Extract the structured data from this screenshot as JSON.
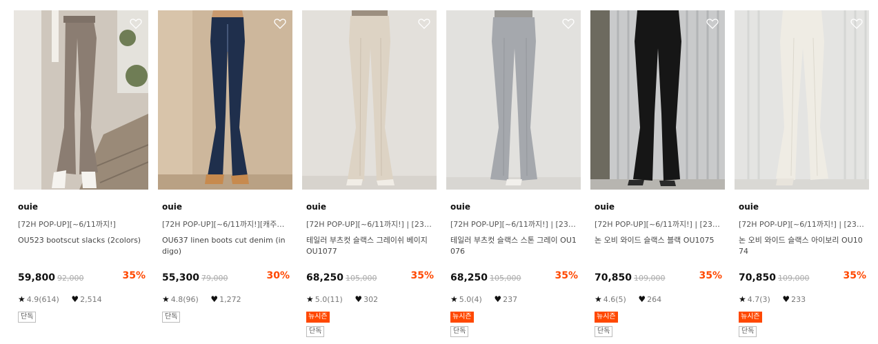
{
  "colors": {
    "accent": "#ff4800",
    "text": "#111111",
    "muted": "#aaaaaa"
  },
  "products": [
    {
      "brand": "ouie",
      "promo": "[72H POP-UP][~6/11까지!]",
      "name": "OU523 bootscut slacks (2colors)",
      "price": "59,800",
      "original_price": "92,000",
      "discount": "35%",
      "rating": "4.9(614)",
      "likes": "2,514",
      "badges": [
        "단독"
      ]
    },
    {
      "brand": "ouie",
      "promo": "[72H POP-UP][~6/11까지!][캐주얼페...",
      "name": "OU637 linen boots cut denim (indigo)",
      "price": "55,300",
      "original_price": "79,000",
      "discount": "30%",
      "rating": "4.8(96)",
      "likes": "1,272",
      "badges": [
        "단독"
      ]
    },
    {
      "brand": "ouie",
      "promo": "[72H POP-UP][~6/11까지!] | [23SU...",
      "name": "테일러 부츠컷 슬랙스 그레이쉬 베이지 OU1077",
      "price": "68,250",
      "original_price": "105,000",
      "discount": "35%",
      "rating": "5.0(11)",
      "likes": "302",
      "badges": [
        "뉴시즌",
        "단독"
      ]
    },
    {
      "brand": "ouie",
      "promo": "[72H POP-UP][~6/11까지!] | [23SU...",
      "name": "테일러 부츠컷 슬랙스 스톤 그레이 OU1076",
      "price": "68,250",
      "original_price": "105,000",
      "discount": "35%",
      "rating": "5.0(4)",
      "likes": "237",
      "badges": [
        "뉴시즌",
        "단독"
      ]
    },
    {
      "brand": "ouie",
      "promo": "[72H POP-UP][~6/11까지!] | [23SU...",
      "name": "논 오비 와이드 슬랙스 블랙 OU1075",
      "price": "70,850",
      "original_price": "109,000",
      "discount": "35%",
      "rating": "4.6(5)",
      "likes": "264",
      "badges": [
        "뉴시즌",
        "단독"
      ]
    },
    {
      "brand": "ouie",
      "promo": "[72H POP-UP][~6/11까지!] | [23SU...",
      "name": "논 오비 와이드 슬랙스 아이보리 OU1074",
      "price": "70,850",
      "original_price": "109,000",
      "discount": "35%",
      "rating": "4.7(3)",
      "likes": "233",
      "badges": [
        "뉴시즌",
        "단독"
      ]
    }
  ]
}
